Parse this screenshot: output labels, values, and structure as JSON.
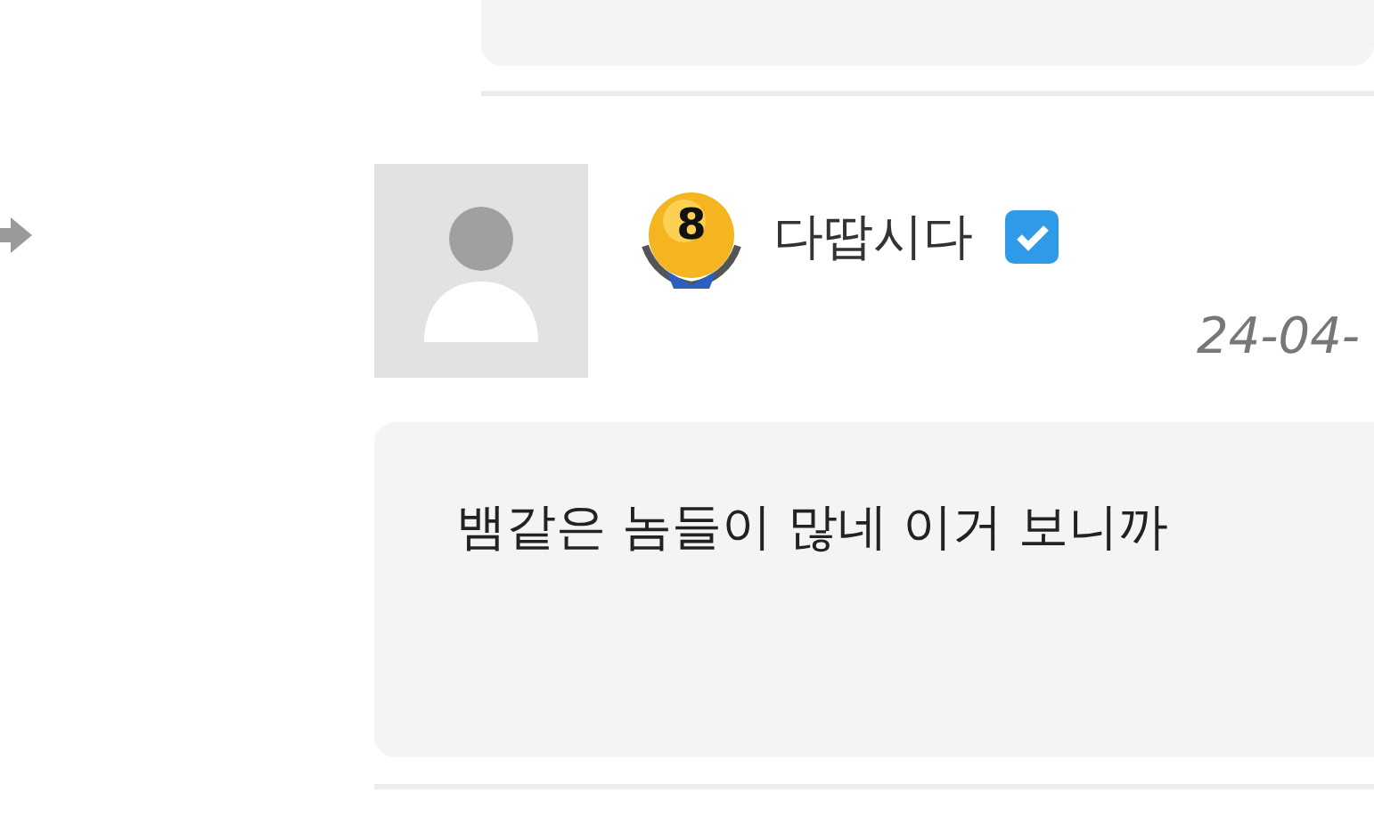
{
  "previous_comment": {
    "kind": "card"
  },
  "reply": {
    "author": "다땁시다",
    "level_badge": "8",
    "verified": true,
    "date": "24-04-",
    "body": "뱀같은 놈들이 많네 이거 보니까"
  }
}
